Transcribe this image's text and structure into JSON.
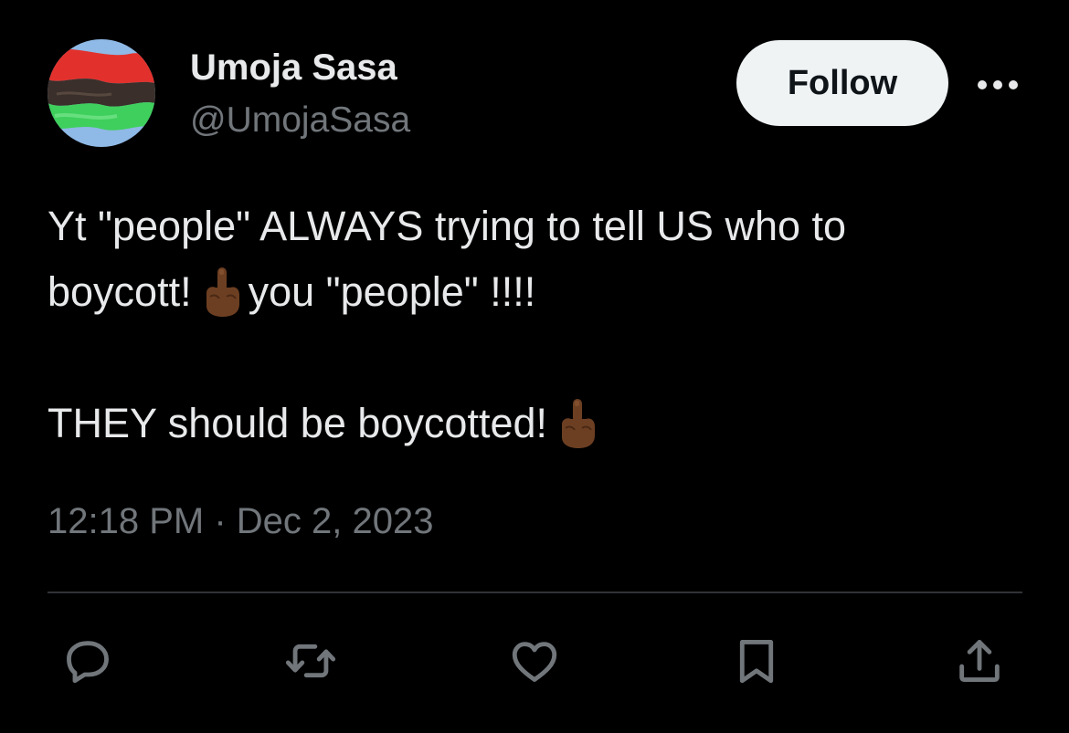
{
  "author": {
    "display_name": "Umoja Sasa",
    "handle": "@UmojaSasa",
    "avatar_icon": "red-black-green-flag-avatar"
  },
  "header": {
    "follow_label": "Follow",
    "more_icon": "more-horizontal-icon"
  },
  "tweet": {
    "line1": "Yt \"people\" ALWAYS trying to tell US who to",
    "line2_before": "boycott!",
    "line2_after": "you \"people\" !!!!",
    "line3": "THEY should be boycotted!",
    "emoji": "middle-finger-emoji-dark-skin-tone",
    "timestamp": "12:18 PM · Dec 2, 2023"
  },
  "actions": {
    "reply_icon": "reply-icon",
    "retweet_icon": "retweet-icon",
    "like_icon": "heart-icon",
    "bookmark_icon": "bookmark-icon",
    "share_icon": "share-icon"
  },
  "colors": {
    "background": "#000000",
    "primary_text": "#e7e9ea",
    "secondary_text": "#71767b",
    "follow_button_bg": "#eff3f4",
    "follow_button_text": "#0f1419",
    "divider": "#2f3336"
  }
}
